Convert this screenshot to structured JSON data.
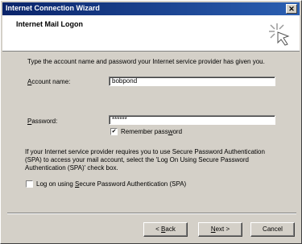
{
  "window": {
    "title": "Internet Connection Wizard",
    "close_label": "✕"
  },
  "header": {
    "title": "Internet Mail Logon",
    "icon": "wizard-sparkle-icon"
  },
  "instruction": "Type the account name and password your Internet service provider has given you.",
  "account": {
    "label_prefix": "",
    "label_key": "A",
    "label_rest": "ccount name:",
    "value": "bobpond"
  },
  "password": {
    "label_prefix": "",
    "label_key": "P",
    "label_rest": "assword:",
    "value": "******"
  },
  "remember": {
    "prefix": "Remember pass",
    "key": "w",
    "rest": "ord",
    "checked": true,
    "mark": "✔"
  },
  "spa_text": "If your Internet service provider requires you to use Secure Password Authentication (SPA) to access your mail account, select the 'Log On Using Secure Password Authentication (SPA)' check box.",
  "spa_checkbox": {
    "prefix": "Log on using ",
    "key": "S",
    "rest": "ecure Password Authentication (SPA)",
    "checked": false
  },
  "buttons": {
    "back": {
      "prefix": "< ",
      "key": "B",
      "rest": "ack"
    },
    "next": {
      "prefix": "",
      "key": "N",
      "rest": "ext >"
    },
    "cancel": "Cancel"
  }
}
